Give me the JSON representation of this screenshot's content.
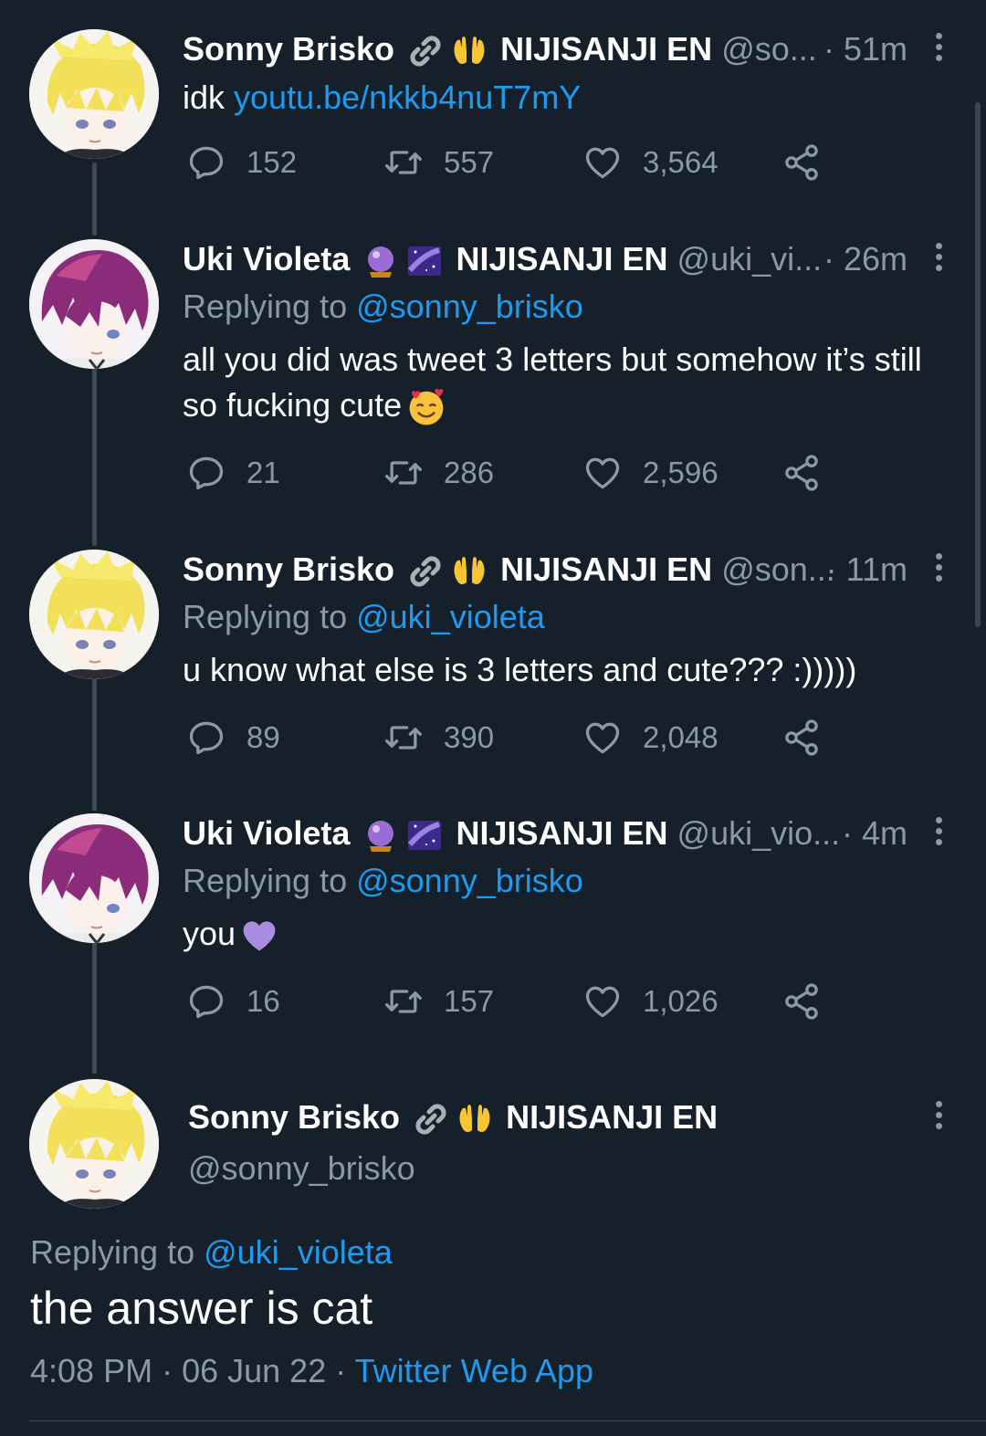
{
  "tweets": [
    {
      "name": "Sonny Brisko",
      "org": "NIJISANJI EN",
      "handle": "@so...",
      "time": "· 51m",
      "body_prefix": "idk ",
      "body_link": "youtu.be/nkkb4nuT7mY",
      "replies": "152",
      "retweets": "557",
      "likes": "3,564"
    },
    {
      "name": "Uki Violeta",
      "org": "NIJISANJI EN",
      "handle": "@uki_vi...",
      "time": "· 26m",
      "replying_label": "Replying to ",
      "replying_to": "@sonny_brisko",
      "body_line1": "all you did was tweet 3 letters but somehow it’s still",
      "body_line2": "so fucking cute",
      "replies": "21",
      "retweets": "286",
      "likes": "2,596"
    },
    {
      "name": "Sonny Brisko",
      "org": "NIJISANJI EN",
      "handle": "@son...",
      "time": "· 11m",
      "replying_label": "Replying to ",
      "replying_to": "@uki_violeta",
      "body": "u know what else is 3 letters and cute??? :)))))",
      "replies": "89",
      "retweets": "390",
      "likes": "2,048"
    },
    {
      "name": "Uki Violeta",
      "org": "NIJISANJI EN",
      "handle": "@uki_vio...",
      "time": "· 4m",
      "replying_label": "Replying to ",
      "replying_to": "@sonny_brisko",
      "body": "you",
      "replies": "16",
      "retweets": "157",
      "likes": "1,026"
    }
  ],
  "main_tweet": {
    "name": "Sonny Brisko",
    "org": "NIJISANJI EN",
    "handle": "@sonny_brisko",
    "replying_label": "Replying to ",
    "replying_to": "@uki_violeta",
    "body": "the answer is cat",
    "time": "4:08 PM",
    "date": "· 06 Jun 22 ·",
    "source": "Twitter Web App"
  },
  "icons": {
    "reply": "reply-icon",
    "retweet": "retweet-icon",
    "like": "heart-icon",
    "share": "share-icon",
    "more": "more-vertical-icon",
    "link_emoji": "link-emoji",
    "hands_emoji": "open-hands-emoji",
    "crystal_emoji": "crystal-ball-emoji",
    "galaxy_emoji": "milky-way-emoji",
    "smile_emoji": "smiling-face-with-hearts-emoji",
    "heart_emoji": "purple-heart-emoji"
  },
  "colors": {
    "background": "#15202b",
    "link": "#1d9bf0",
    "secondary_text": "#8b98a5"
  }
}
